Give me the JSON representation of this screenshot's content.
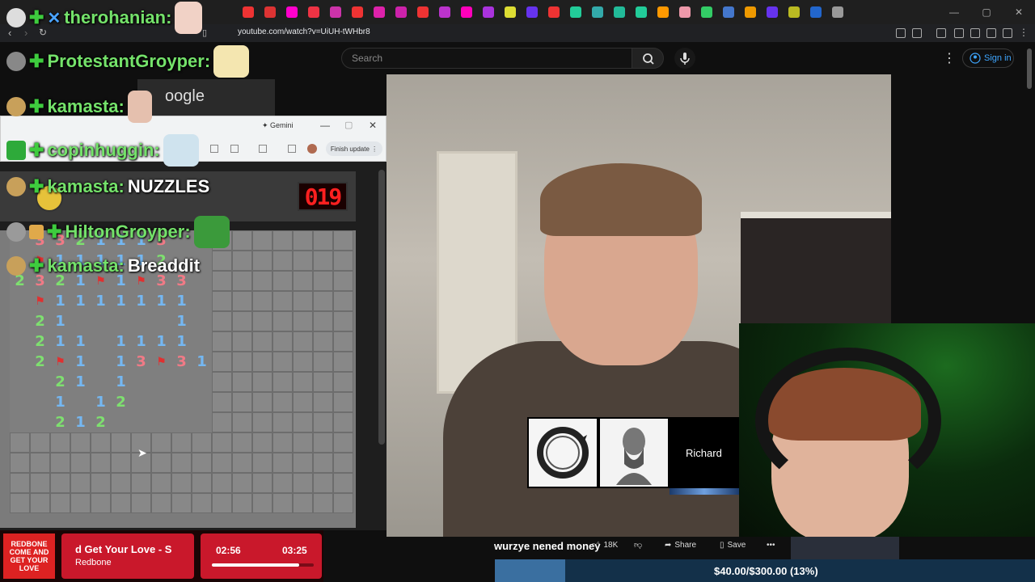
{
  "browser": {
    "url": "youtube.com/watch?v=UiUH-tWHbr8",
    "window_controls": [
      "—",
      "▢",
      "✕"
    ]
  },
  "youtube": {
    "search_placeholder": "Search",
    "signin_label": "Sign in",
    "video_title": "wurzye nened money",
    "likes": "18K",
    "share_label": "Share",
    "save_label": "Save"
  },
  "video_overlay": {
    "caption_name": "Richard"
  },
  "gemini_window": {
    "title": "Gemini",
    "finish_update": "Finish update",
    "partial_text": "oogle"
  },
  "minesweeper": {
    "timer": "019",
    "rows": [
      [
        "",
        "3",
        "3",
        "2",
        "1",
        "1",
        "1",
        "3",
        "",
        "",
        "",
        "",
        "",
        "",
        "",
        "",
        ""
      ],
      [
        "",
        "F",
        "1",
        "1",
        "1",
        "1",
        "1",
        "2",
        "",
        "",
        "",
        "",
        "",
        "",
        "",
        "",
        ""
      ],
      [
        "2",
        "3",
        "2",
        "1",
        "F",
        "1",
        "F",
        "3",
        "3",
        "",
        "",
        "",
        "",
        "",
        "",
        "",
        ""
      ],
      [
        "",
        "F",
        "1",
        "1",
        "1",
        "1",
        "1",
        "1",
        "1",
        "",
        "",
        "",
        "",
        "",
        "",
        "",
        ""
      ],
      [
        "",
        "2",
        "1",
        "",
        "",
        "",
        "",
        "",
        "1",
        "",
        "",
        "",
        "",
        "",
        "",
        "",
        ""
      ],
      [
        "",
        "2",
        "1",
        "1",
        "",
        "1",
        "1",
        "1",
        "1",
        "",
        "",
        "",
        "",
        "",
        "",
        "",
        ""
      ],
      [
        "",
        "2",
        "F",
        "1",
        "",
        "1",
        "3",
        "F",
        "3",
        "1",
        "",
        "",
        "",
        "",
        "",
        "",
        ""
      ],
      [
        "",
        "",
        "2",
        "1",
        "",
        "1",
        "",
        "",
        "",
        "",
        "",
        "",
        "",
        "",
        "",
        "",
        ""
      ],
      [
        "",
        "",
        "1",
        "",
        "1",
        "2",
        "",
        "",
        "",
        "",
        "",
        "",
        "",
        "",
        "",
        "",
        ""
      ],
      [
        "",
        "",
        "2",
        "1",
        "2",
        "",
        "",
        "",
        "",
        "",
        "",
        "",
        "",
        "",
        "",
        "",
        ""
      ]
    ]
  },
  "chat": [
    {
      "name": "therohanian:",
      "msg": ""
    },
    {
      "name": "ProtestantGroyper:",
      "msg": ""
    },
    {
      "name": "kamasta:",
      "msg": ""
    },
    {
      "name": "copinhuggin:",
      "msg": ""
    },
    {
      "name": "kamasta:",
      "msg": "NUZZLES"
    },
    {
      "name": "HiltonGroyper:",
      "msg": ""
    },
    {
      "name": "kamasta:",
      "msg": "Breaddit"
    }
  ],
  "music": {
    "album_text": "REDBONE COME AND GET YOUR LOVE",
    "song_title": "d Get Your Love - S",
    "artist": "Redbone",
    "current_time": "02:56",
    "total_time": "03:25",
    "progress_fraction": 0.86
  },
  "goal": {
    "text": "$40.00/$300.00 (13%)",
    "fraction": 0.13
  },
  "colors": {
    "chat_name": "#74e26a",
    "minesweeper_1": "#74b7f2",
    "minesweeper_2": "#7ee06f",
    "minesweeper_3": "#f07a86",
    "goal_fill": "#3a6fa0",
    "music_red": "#c9182b"
  }
}
